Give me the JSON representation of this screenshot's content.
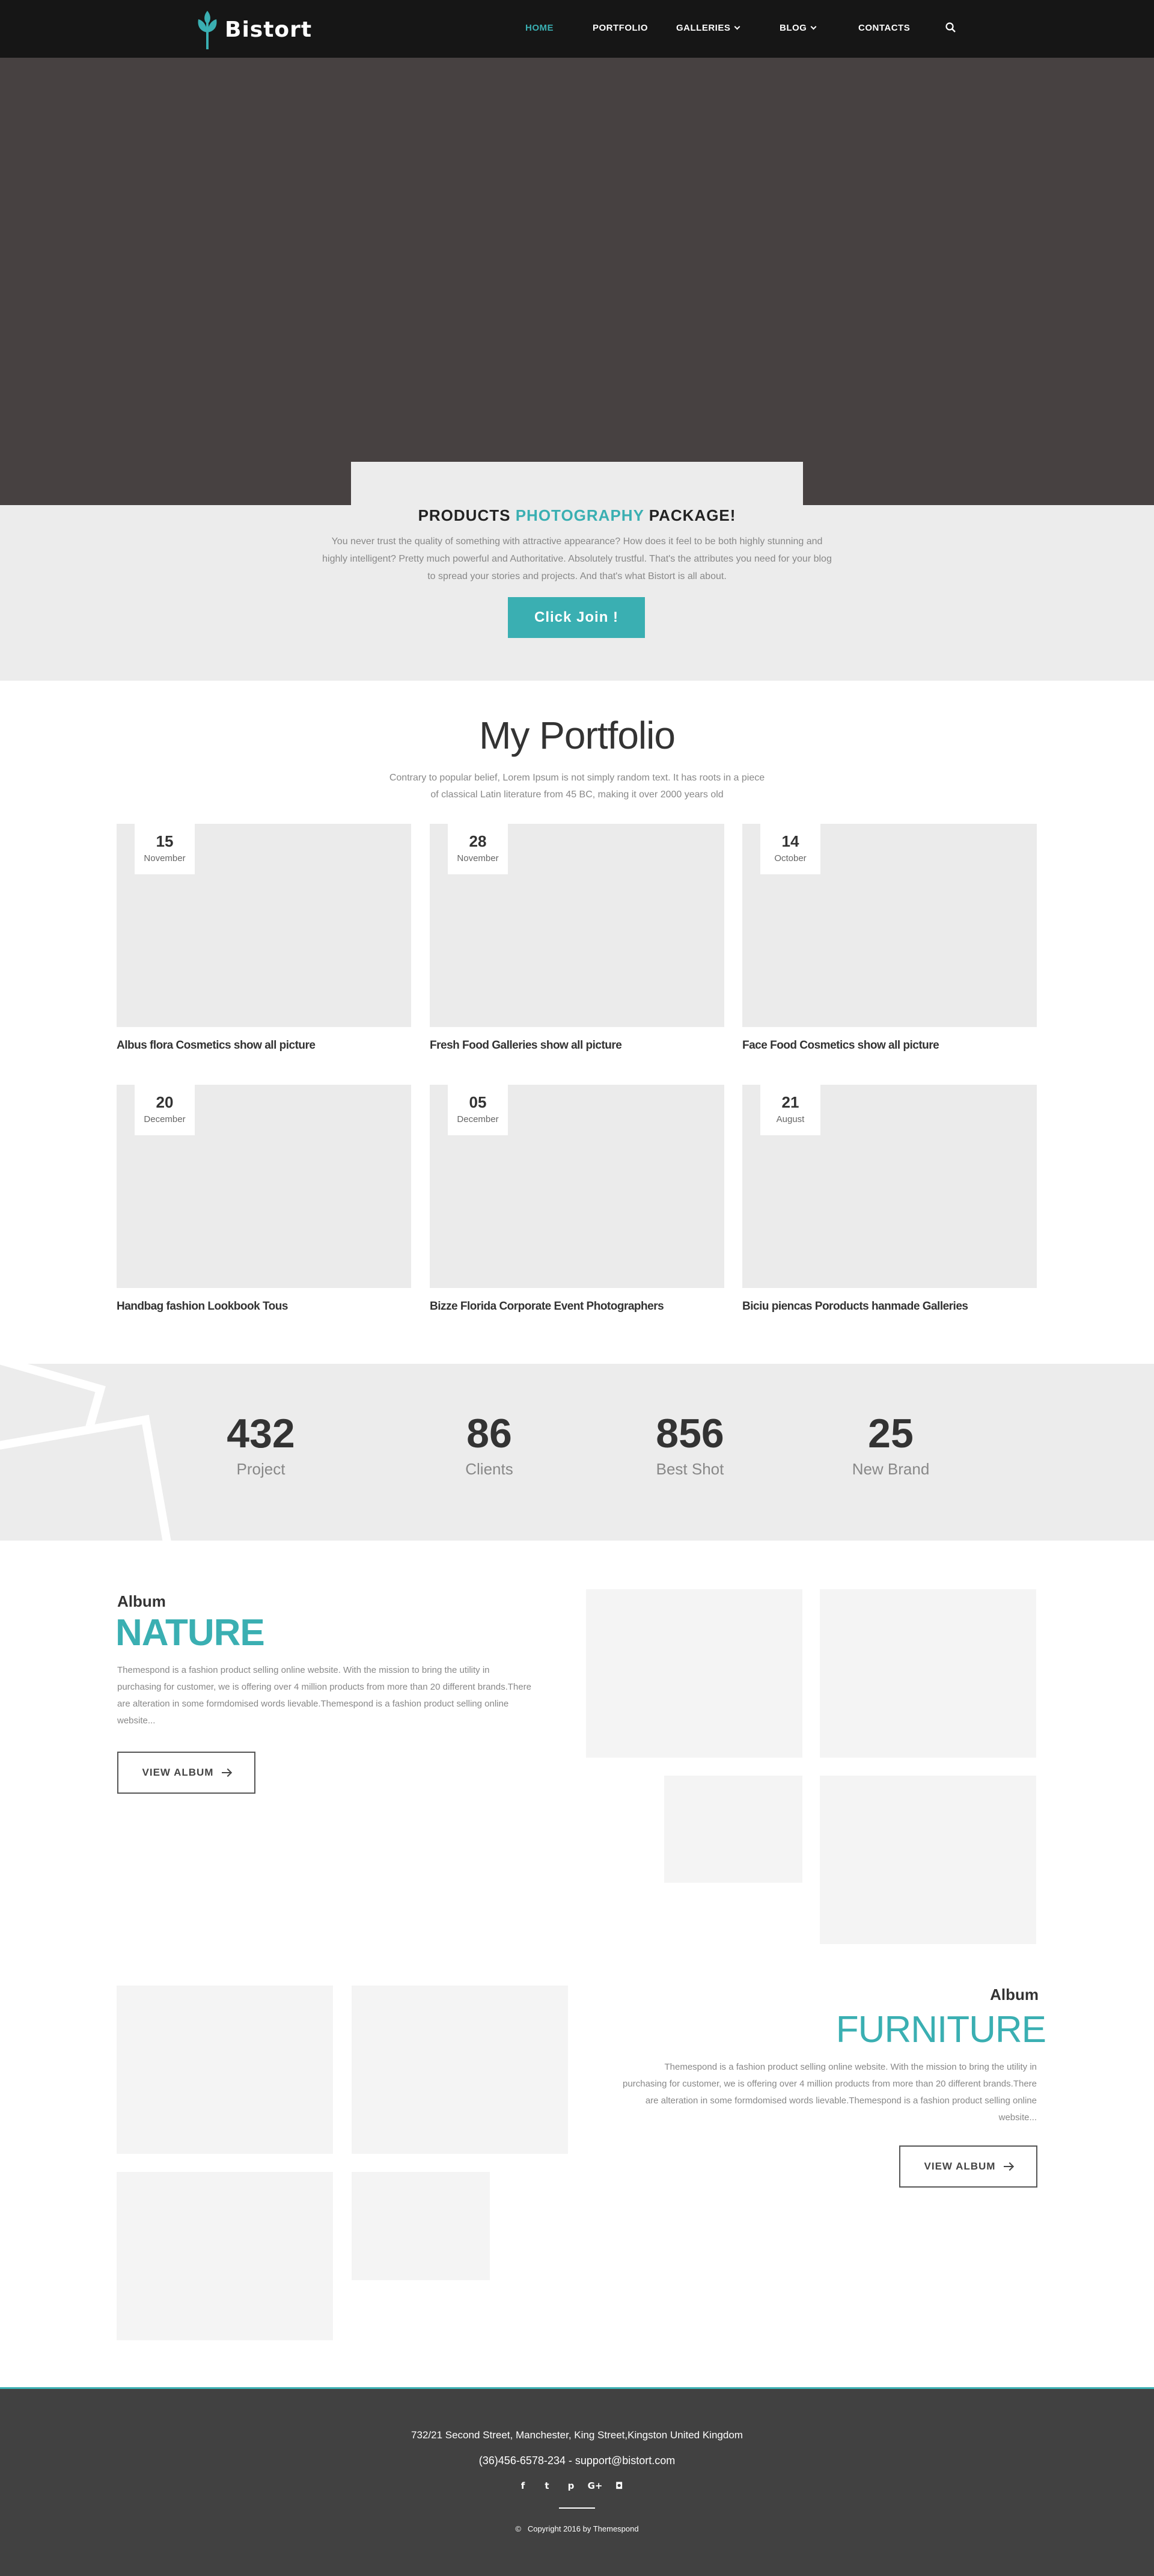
{
  "brand": {
    "name": "Bistort",
    "accent": "#3aafb2"
  },
  "nav": {
    "home": "HOME",
    "portfolio": "PORTFOLIO",
    "galleries": "GALLERIES",
    "blog": "BLOG",
    "contacts": "CONTACTS",
    "search_icon": "search-icon"
  },
  "hero": {
    "slides": 3,
    "active_slide": 3
  },
  "package": {
    "title_pre": "PRODUCTS",
    "title_accent": "PHOTOGRAPHY",
    "title_post": "PACKAGE!",
    "text_line1": "You never trust the quality of something with attractive appearance? How does it feel to be both highly stunning and",
    "text_line2": "highly intelligent? Pretty much powerful and Authoritative. Absolutely trustful. That's the attributes you need for your blog",
    "text_line3": "to spread your stories and projects. And that's what Bistort is all about.",
    "button": "Click Join !"
  },
  "portfolio": {
    "title": "My Portfolio",
    "sub_line1": "Contrary to popular belief, Lorem Ipsum is not simply random text. It has roots in a piece",
    "sub_line2": "of classical Latin literature from 45 BC, making it over 2000 years old",
    "items": [
      {
        "day": "15",
        "month": "November",
        "title": "Albus flora Cosmetics show all picture"
      },
      {
        "day": "28",
        "month": "November",
        "title": "Fresh Food Galleries show all picture"
      },
      {
        "day": "14",
        "month": "October",
        "title": "Face Food Cosmetics show all picture"
      },
      {
        "day": "20",
        "month": "December",
        "title": "Handbag fashion Lookbook Tous"
      },
      {
        "day": "05",
        "month": "December",
        "title": "Bizze Florida Corporate Event Photographers"
      },
      {
        "day": "21",
        "month": "August",
        "title": "Biciu piencas Poroducts hanmade Galleries"
      }
    ]
  },
  "counters": [
    {
      "value": "432",
      "label": "Project"
    },
    {
      "value": "86",
      "label": "Clients"
    },
    {
      "value": "856",
      "label": "Best Shot"
    },
    {
      "value": "25",
      "label": "New Brand"
    }
  ],
  "album_nature": {
    "label": "Album",
    "name": "NATURE",
    "line1": "Themespond is a fashion product selling online website. With the mission to bring the utility in",
    "line2": "purchasing for customer, we is offering over 4 million products from more than 20 different brands.There",
    "line3": "are alteration in some formdomised words lievable.Themespond is a fashion product selling online",
    "line4": "website...",
    "button": "VIEW ALBUM"
  },
  "album_furniture": {
    "label": "Album",
    "name": "FURNITURE",
    "line1": "Themespond is a fashion product selling online website. With the mission to bring the utility in",
    "line2": "purchasing for customer, we is offering over 4 million products from more than 20 different brands.There",
    "line3": "are alteration in some formdomised words lievable.Themespond is a fashion product selling online",
    "line4": "website...",
    "button": "VIEW ALBUM"
  },
  "footer": {
    "address": "732/21 Second Street, Manchester, King Street,Kingston United Kingdom",
    "contact": "(36)456-6578-234  -  support@bistort.com",
    "social": {
      "facebook": "f",
      "twitter": "t",
      "pinterest": "p",
      "googleplus": "G+",
      "instagram": "◘"
    },
    "copyright": "Copyright 2016 by Themespond",
    "copyright_symbol": "©"
  }
}
